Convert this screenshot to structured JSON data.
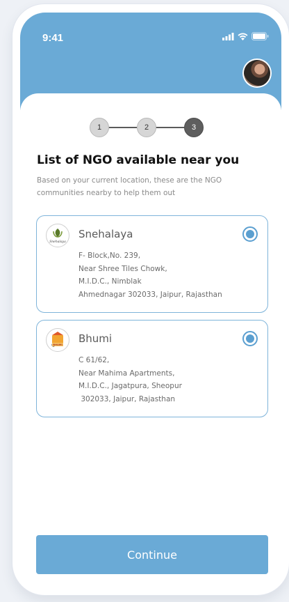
{
  "status_bar": {
    "time": "9:41"
  },
  "stepper": {
    "steps": [
      "1",
      "2",
      "3"
    ],
    "current": 3
  },
  "page": {
    "title": "List of NGO available near you",
    "subtitle": "Based on your current location, these are the NGO communities nearby to help them out"
  },
  "ngos": [
    {
      "name": "Snehalaya",
      "logo_text": "Snehalaya",
      "selected": true,
      "address": [
        "F- Block,No. 239,",
        "Near Shree Tiles Chowk,",
        "M.I.D.C., Nimblak",
        "Ahmednagar 302033, Jaipur, Rajasthan"
      ]
    },
    {
      "name": "Bhumi",
      "logo_text": "BHUMI",
      "selected": true,
      "address": [
        "C 61/62,",
        "Near Mahima Apartments,",
        "M.I.D.C., Jagatpura, Sheopur",
        " 302033, Jaipur, Rajasthan"
      ]
    }
  ],
  "continue_label": "Continue",
  "colors": {
    "primary": "#6aaad6",
    "radio": "#5b9fd0",
    "card_border": "#7eb4da"
  },
  "icons": {
    "signal": "signal-icon",
    "wifi": "wifi-icon",
    "battery": "battery-icon"
  }
}
